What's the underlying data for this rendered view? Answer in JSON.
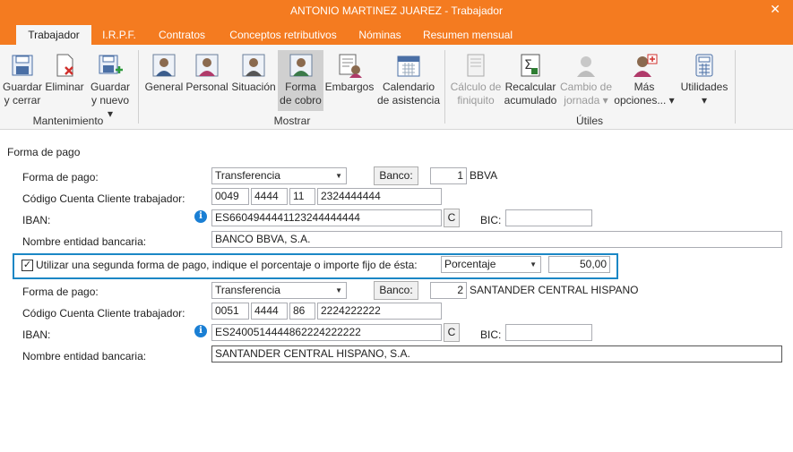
{
  "window": {
    "title": "ANTONIO MARTINEZ JUAREZ - Trabajador",
    "close": "✕"
  },
  "tabs": [
    "Trabajador",
    "I.R.P.F.",
    "Contratos",
    "Conceptos retributivos",
    "Nóminas",
    "Resumen mensual"
  ],
  "ribbon": {
    "groups": {
      "mantenimiento": "Mantenimiento",
      "mostrar": "Mostrar",
      "utiles": "Útiles"
    },
    "buttons": {
      "guardar_cerrar": [
        "Guardar",
        "y cerrar"
      ],
      "eliminar": [
        "Eliminar"
      ],
      "guardar_nuevo": [
        "Guardar",
        "y nuevo ▾"
      ],
      "general": [
        "General"
      ],
      "personal": [
        "Personal"
      ],
      "situacion": [
        "Situación"
      ],
      "forma_cobro": [
        "Forma",
        "de cobro"
      ],
      "embargos": [
        "Embargos"
      ],
      "calendario": [
        "Calendario",
        "de asistencia"
      ],
      "calculo_finiquito": [
        "Cálculo de",
        "finiquito"
      ],
      "recalcular": [
        "Recalcular",
        "acumulado"
      ],
      "cambio_jornada": [
        "Cambio de",
        "jornada ▾"
      ],
      "mas_opciones": [
        "Más",
        "opciones... ▾"
      ],
      "utilidades": [
        "Utilidades",
        "▾"
      ]
    }
  },
  "form": {
    "section_title": "Forma de pago",
    "pago1": {
      "forma_label": "Forma de pago:",
      "forma_value": "Transferencia",
      "banco_button": "Banco:",
      "banco_num": "1",
      "banco_name": "BBVA",
      "ccc_label": "Código Cuenta Cliente trabajador:",
      "ccc": [
        "0049",
        "4444",
        "11",
        "2324444444"
      ],
      "iban_label": "IBAN:",
      "iban": "ES6604944441123244444444",
      "c_button": "C",
      "bic_label": "BIC:",
      "bic": "",
      "entidad_label": "Nombre entidad bancaria:",
      "entidad": "BANCO BBVA, S.A."
    },
    "segunda": {
      "checked": true,
      "label": "Utilizar una segunda forma de pago, indique el porcentaje o importe fijo de ésta:",
      "tipo": "Porcentaje",
      "valor": "50,00"
    },
    "pago2": {
      "forma_label": "Forma de pago:",
      "forma_value": "Transferencia",
      "banco_button": "Banco:",
      "banco_num": "2",
      "banco_name": "SANTANDER CENTRAL HISPANO",
      "ccc_label": "Código Cuenta Cliente trabajador:",
      "ccc": [
        "0051",
        "4444",
        "86",
        "2224222222"
      ],
      "iban_label": "IBAN:",
      "iban": "ES2400514444862224222222",
      "c_button": "C",
      "bic_label": "BIC:",
      "bic": "",
      "entidad_label": "Nombre entidad bancaria:",
      "entidad": "SANTANDER CENTRAL HISPANO, S.A."
    }
  },
  "colors": {
    "accent": "#f47b20",
    "highlight_frame": "#1b87c5",
    "info": "#1a7fd4"
  }
}
